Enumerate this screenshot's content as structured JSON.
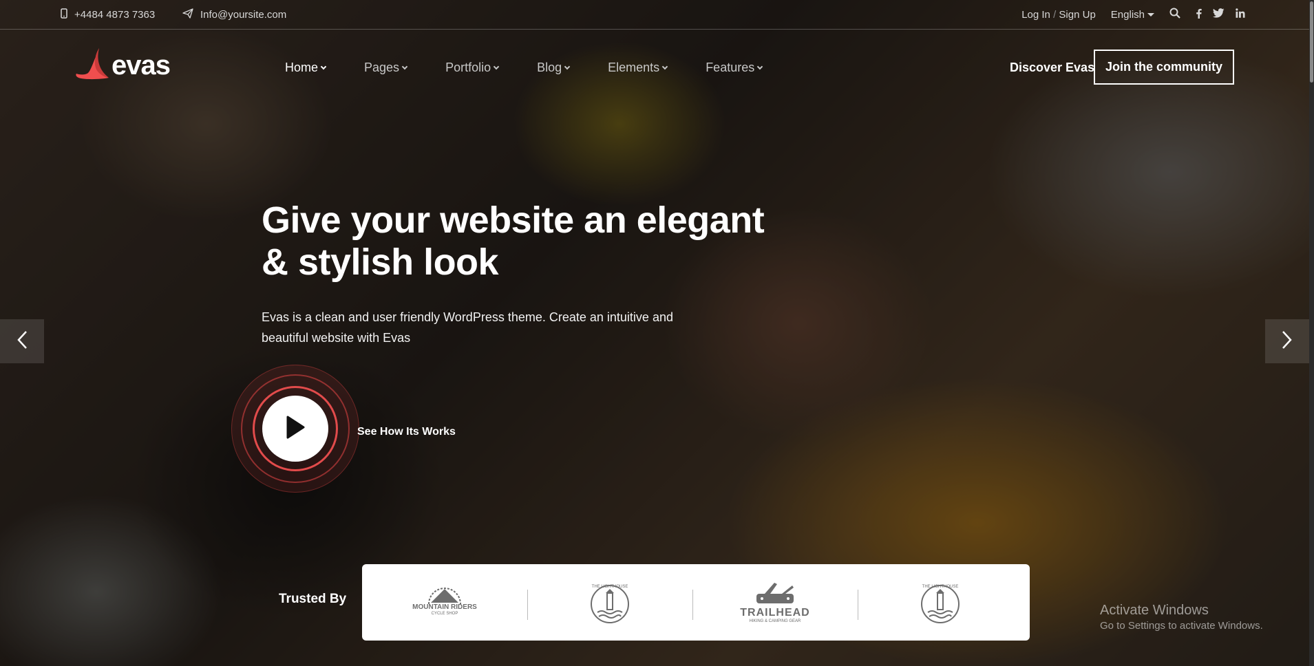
{
  "topbar": {
    "phone": "+4484 4873 7363",
    "email": "Info@yoursite.com",
    "login": "Log In",
    "separator": "/",
    "signup": "Sign Up",
    "language": "English",
    "social": [
      "facebook-icon",
      "twitter-icon",
      "linkedin-icon"
    ]
  },
  "nav": {
    "logo": "evas",
    "items": [
      {
        "label": "Home",
        "active": true
      },
      {
        "label": "Pages"
      },
      {
        "label": "Portfolio"
      },
      {
        "label": "Blog"
      },
      {
        "label": "Elements"
      },
      {
        "label": "Features"
      }
    ],
    "discover": "Discover Evas",
    "cta": "Join the community"
  },
  "hero": {
    "title_line1": "Give your website an elegant",
    "title_line2": "& stylish look",
    "desc_line1": "Evas is a clean and user friendly WordPress theme. Create an intuitive and",
    "desc_line2": "beautiful website with Evas",
    "play_label": "See How Its Works"
  },
  "trusted": {
    "label": "Trusted By",
    "partners": [
      {
        "name": "MOUNTAIN RIDERS",
        "sub": "CYCLE SHOP"
      },
      {
        "name": "THE LIGHTHOUSE"
      },
      {
        "name": "TRAILHEAD",
        "sub": "HIKING & CAMPING GEAR"
      },
      {
        "name": "THE LIGHTHOUSE"
      }
    ]
  },
  "watermark": {
    "line1": "Activate Windows",
    "line2": "Go to Settings to activate Windows."
  },
  "colors": {
    "accent": "#f04e4e",
    "accent_ring": "#e24b4b"
  }
}
